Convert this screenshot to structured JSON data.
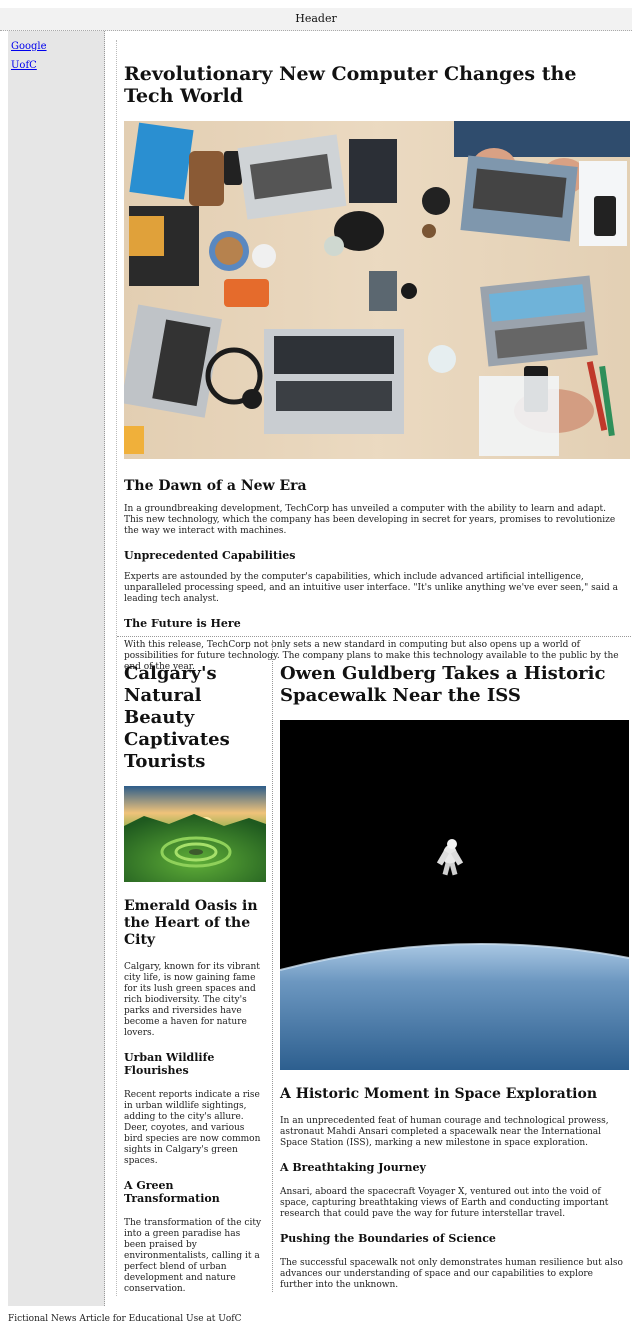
{
  "header": {
    "title": "Header"
  },
  "sidebar": {
    "links": [
      "Google",
      "UofC"
    ]
  },
  "main": {
    "article1": {
      "title": "Revolutionary New Computer Changes the Tech World",
      "h2": "The Dawn of a New Era",
      "p1": "In a groundbreaking development, TechCorp has unveiled a computer with the ability to learn and adapt. This new technology, which the company has been developing in secret for years, promises to revolutionize the way we interact with machines.",
      "h3a": "Unprecedented Capabilities",
      "p2": "Experts are astounded by the computer's capabilities, which include advanced artificial intelligence, unparalleled processing speed, and an intuitive user interface. \"It's unlike anything we've ever seen,\" said a leading tech analyst.",
      "h3b": "The Future is Here",
      "p3": "With this release, TechCorp not only sets a new standard in computing but also opens up a world of possibilities for future technology. The company plans to make this technology available to the public by the end of the year."
    },
    "article2": {
      "title": "Calgary's Natural Beauty Captivates Tourists",
      "h2": "Emerald Oasis in the Heart of the City",
      "p1": "Calgary, known for its vibrant city life, is now gaining fame for its lush green spaces and rich biodiversity. The city's parks and riversides have become a haven for nature lovers.",
      "h3a": "Urban Wildlife Flourishes",
      "p2": "Recent reports indicate a rise in urban wildlife sightings, adding to the city's allure. Deer, coyotes, and various bird species are now common sights in Calgary's green spaces.",
      "h3b": "A Green Transformation",
      "p3": "The transformation of the city into a green paradise has been praised by environmentalists, calling it a perfect blend of urban development and nature conservation."
    },
    "article3": {
      "title": "Owen Guldberg Takes a Historic Spacewalk Near the ISS",
      "h2": "A Historic Moment in Space Exploration",
      "p1": "In an unprecedented feat of human courage and technological prowess, astronaut Mahdi Ansari completed a spacewalk near the International Space Station (ISS), marking a new milestone in space exploration.",
      "h3a": "A Breathtaking Journey",
      "p2": "Ansari, aboard the spacecraft Voyager X, ventured out into the void of space, capturing breathtaking views of Earth and conducting important research that could pave the way for future interstellar travel.",
      "h3b": "Pushing the Boundaries of Science",
      "p3": "The successful spacewalk not only demonstrates human resilience but also advances our understanding of space and our capabilities to explore further into the unknown."
    }
  },
  "footer": {
    "text": "Fictional News Article for Educational Use at UofC"
  }
}
